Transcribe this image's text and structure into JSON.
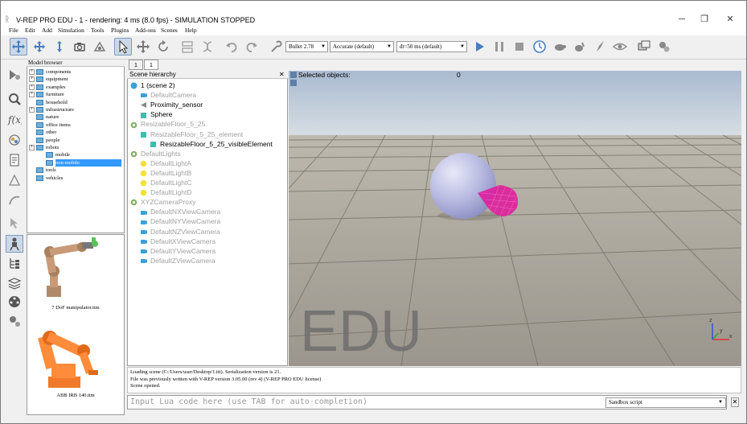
{
  "window": {
    "title": "V-REP PRO EDU - 1 - rendering: 4 ms (8.0 fps) - SIMULATION STOPPED",
    "app_icon": "v-rep-icon",
    "buttons": {
      "minimize": "─",
      "restore": "❐",
      "close": "✕"
    }
  },
  "menu": [
    "File",
    "Edit",
    "Add",
    "Simulation",
    "Tools",
    "Plugins",
    "Add-ons",
    "Scenes",
    "Help"
  ],
  "toolbar": {
    "physics_engine": "Bullet 2.78",
    "accuracy": "Accurate (default)",
    "time_step": "dt=50 ms (default)"
  },
  "model_browser": {
    "title": "Model browser",
    "items": [
      {
        "label": "components",
        "expandable": true,
        "indent": 0
      },
      {
        "label": "equipment",
        "expandable": true,
        "indent": 0
      },
      {
        "label": "examples",
        "expandable": true,
        "indent": 0
      },
      {
        "label": "furniture",
        "expandable": true,
        "indent": 0
      },
      {
        "label": "household",
        "expandable": false,
        "indent": 0
      },
      {
        "label": "infrastructure",
        "expandable": true,
        "indent": 0
      },
      {
        "label": "nature",
        "expandable": false,
        "indent": 0
      },
      {
        "label": "office items",
        "expandable": false,
        "indent": 0
      },
      {
        "label": "other",
        "expandable": false,
        "indent": 0
      },
      {
        "label": "people",
        "expandable": false,
        "indent": 0
      },
      {
        "label": "robots",
        "expandable": true,
        "indent": 0
      },
      {
        "label": "mobile",
        "expandable": false,
        "indent": 1
      },
      {
        "label": "non-mobile",
        "expandable": false,
        "indent": 1,
        "selected": true
      },
      {
        "label": "tools",
        "expandable": false,
        "indent": 0
      },
      {
        "label": "vehicles",
        "expandable": false,
        "indent": 0
      }
    ],
    "thumbnails": [
      {
        "label": "7 DoF manipulator.ttm"
      },
      {
        "label": "ABB IRB 140.ttm"
      }
    ]
  },
  "scene_tabs": [
    "1",
    "1"
  ],
  "scene_hierarchy": {
    "title": "Scene hierarchy",
    "rows": [
      {
        "label": "1 (scene 2)",
        "gray": false,
        "indent": 0,
        "icon": "scene-icon"
      },
      {
        "label": "DefaultCamera",
        "gray": true,
        "indent": 1,
        "icon": "camera-icon"
      },
      {
        "label": "Proximity_sensor",
        "gray": false,
        "indent": 1,
        "icon": "proximity-sensor-icon"
      },
      {
        "label": "Sphere",
        "gray": false,
        "indent": 1,
        "icon": "shape-icon"
      },
      {
        "label": "ResizableFloor_5_25",
        "gray": true,
        "indent": 0,
        "icon": "dummy-icon"
      },
      {
        "label": "ResizableFloor_5_25_element",
        "gray": true,
        "indent": 1,
        "icon": "shape-icon"
      },
      {
        "label": "ResizableFloor_5_25_visibleElement",
        "gray": false,
        "indent": 2,
        "icon": "shape-icon"
      },
      {
        "label": "DefaultLights",
        "gray": true,
        "indent": 0,
        "icon": "dummy-icon"
      },
      {
        "label": "DefaultLightA",
        "gray": true,
        "indent": 1,
        "icon": "light-icon"
      },
      {
        "label": "DefaultLightB",
        "gray": true,
        "indent": 1,
        "icon": "light-icon"
      },
      {
        "label": "DefaultLightC",
        "gray": true,
        "indent": 1,
        "icon": "light-icon"
      },
      {
        "label": "DefaultLightD",
        "gray": true,
        "indent": 1,
        "icon": "light-icon"
      },
      {
        "label": "XYZCameraProxy",
        "gray": true,
        "indent": 0,
        "icon": "dummy-icon"
      },
      {
        "label": "DefaultNXViewCamera",
        "gray": true,
        "indent": 1,
        "icon": "camera-icon"
      },
      {
        "label": "DefaultNYViewCamera",
        "gray": true,
        "indent": 1,
        "icon": "camera-icon"
      },
      {
        "label": "DefaultNZViewCamera",
        "gray": true,
        "indent": 1,
        "icon": "camera-icon"
      },
      {
        "label": "DefaultXViewCamera",
        "gray": true,
        "indent": 1,
        "icon": "camera-icon"
      },
      {
        "label": "DefaultYViewCamera",
        "gray": true,
        "indent": 1,
        "icon": "camera-icon"
      },
      {
        "label": "DefaultZViewCamera",
        "gray": true,
        "indent": 1,
        "icon": "camera-icon"
      }
    ]
  },
  "viewport": {
    "selected_label": "Selected objects:",
    "selected_count": "0",
    "watermark": "EDU",
    "axes": {
      "x": "x",
      "y": "y",
      "z": "z"
    }
  },
  "console": {
    "lines": [
      "Loading scene (C:/Users/user/Desktop/1.ttt). Serialization version is 21.",
      "File was previously written with V-REP version 3.05.00 (rev 4) (V-REP PRO EDU license)",
      "Scene opened."
    ]
  },
  "lua": {
    "placeholder": "Input Lua code here (use TAB for auto-completion)",
    "script_target": "Sandbox script"
  },
  "colors": {
    "selection": "#3399ff",
    "sky_top": "#aebfd4",
    "floor": "#a8a39a",
    "sphere": "#b7b9e3",
    "sensor": "#e0189c"
  }
}
